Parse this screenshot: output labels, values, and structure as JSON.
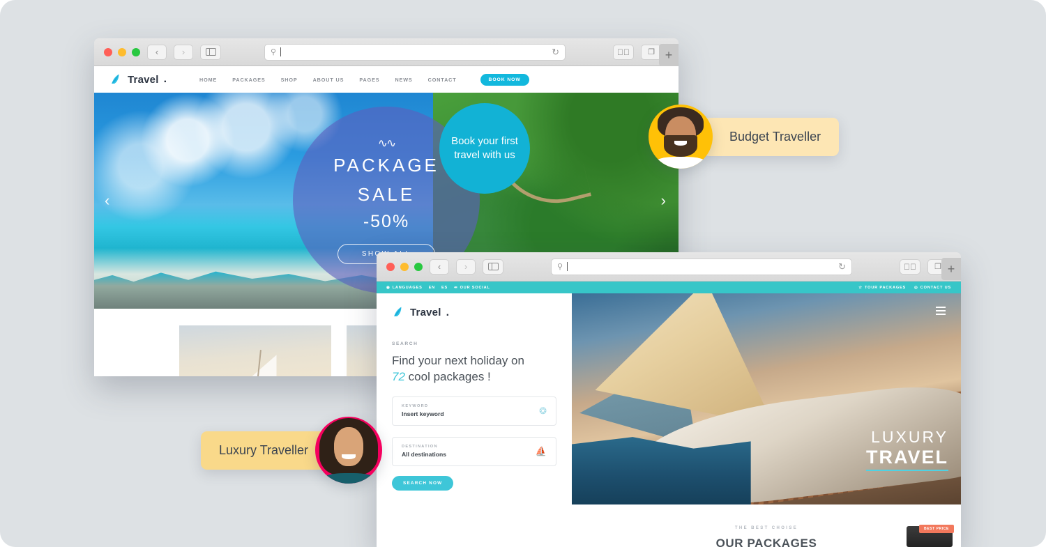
{
  "background_color": "#dde1e4",
  "browser": {
    "traffic_lights": [
      "close",
      "minimize",
      "maximize"
    ],
    "back_label": "‹",
    "forward_label": "›",
    "sidebar_icon": "sidebar-icon",
    "address_placeholder": "",
    "address_value": "",
    "search_icon": "search-icon",
    "reload_icon": "reload-icon",
    "share_icon": "share-icon",
    "tabs_icon": "tab-overview-icon",
    "new_tab_label": "+"
  },
  "window1": {
    "brand": {
      "name": "Travel",
      "dot": "."
    },
    "menu": [
      {
        "label": "HOME"
      },
      {
        "label": "PACKAGES"
      },
      {
        "label": "SHOP"
      },
      {
        "label": "ABOUT US"
      },
      {
        "label": "PAGES"
      },
      {
        "label": "NEWS"
      },
      {
        "label": "CONTACT"
      }
    ],
    "cta": "BOOK NOW",
    "hero": {
      "wave_icon": "∿∿",
      "line1": "PACKAGE",
      "line2": "SALE",
      "line3": "-50%",
      "button": "SHOW ALL",
      "badge": "Book your first travel with us",
      "prev_arrow": "‹",
      "next_arrow": "›"
    }
  },
  "window2": {
    "topbar": {
      "globe_icon": "globe-icon",
      "languages": "LANGUAGES",
      "lang_en": "EN",
      "lang_es": "ES",
      "share_icon": "share-nodes-icon",
      "our_social": "OUR SOCIAL",
      "star_icon": "star-icon",
      "tour_packages": "TOUR PACKAGES",
      "pin_icon": "location-pin-icon",
      "contact_us": "CONTACT US"
    },
    "brand": {
      "name": "Travel",
      "dot": "."
    },
    "search_panel": {
      "kicker": "SEARCH",
      "headline_part1": "Find your next holiday on",
      "headline_number": "72",
      "headline_part2": "cool packages !",
      "fields": [
        {
          "label": "KEYWORD",
          "value": "Insert keyword",
          "icon": "compass-icon"
        },
        {
          "label": "DESTINATION",
          "value": "All destinations",
          "icon": "sailboat-icon"
        }
      ],
      "button": "SEARCH NOW"
    },
    "hero": {
      "title_top": "LUXURY",
      "title_bottom": "TRAVEL",
      "menu_icon": "hamburger-menu-icon"
    },
    "packages": {
      "kicker": "THE BEST CHOISE",
      "title_prefix": "OUR ",
      "title_underlined": "PACKAGES",
      "card_badge": "BEST PRICE"
    }
  },
  "personas": [
    {
      "id": "budget",
      "label": "Budget Traveller",
      "avatar_color": "#ffc107",
      "chip_color": "#fde6b4"
    },
    {
      "id": "luxury",
      "label": "Luxury Traveller",
      "avatar_color": "#f5005e",
      "chip_color": "#f9d98a"
    }
  ]
}
